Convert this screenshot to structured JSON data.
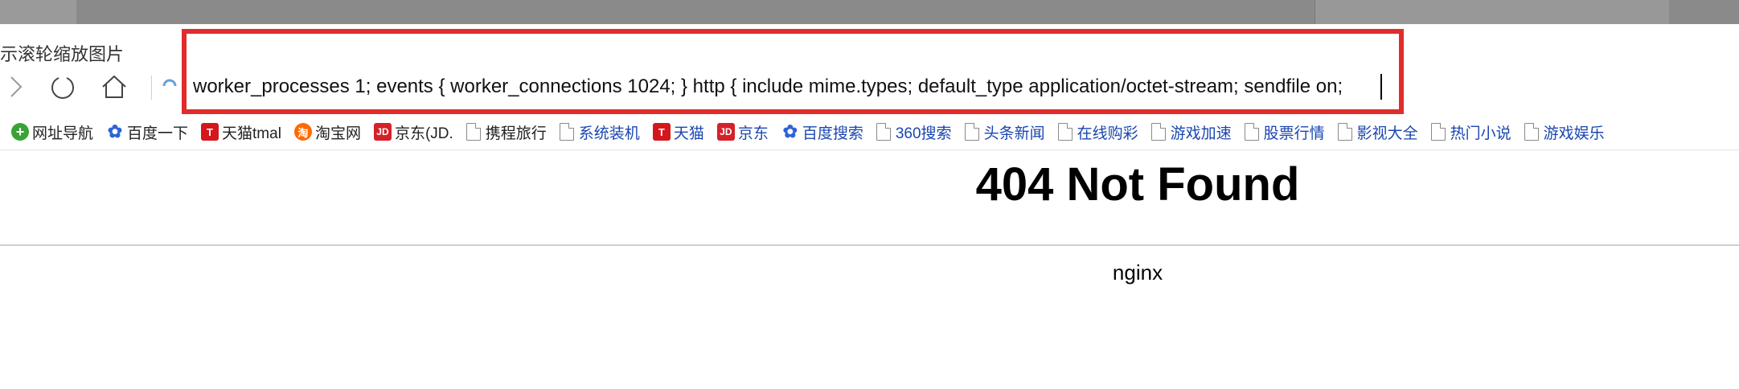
{
  "browser": {
    "tab_title": "示滚轮缩放图片",
    "address_bar_value": "worker_processes 1; events { worker_connections 1024; } http { include mime.types; default_type application/octet-stream; sendfile on;"
  },
  "bookmarks": [
    {
      "label": "网址导航",
      "icon": "green-plus-icon"
    },
    {
      "label": "百度一下",
      "icon": "baidu-paw-icon"
    },
    {
      "label": "天猫tmal",
      "icon": "tmall-icon"
    },
    {
      "label": "淘宝网",
      "icon": "taobao-icon"
    },
    {
      "label": "京东(JD.",
      "icon": "jd-icon"
    },
    {
      "label": "携程旅行",
      "icon": "page-icon"
    },
    {
      "label": "系统装机",
      "icon": "page-icon"
    },
    {
      "label": "天猫",
      "icon": "tmall-icon"
    },
    {
      "label": "京东",
      "icon": "jd-icon"
    },
    {
      "label": "百度搜索",
      "icon": "baidu-paw-icon"
    },
    {
      "label": "360搜索",
      "icon": "page-icon"
    },
    {
      "label": "头条新闻",
      "icon": "page-icon"
    },
    {
      "label": "在线购彩",
      "icon": "page-icon"
    },
    {
      "label": "游戏加速",
      "icon": "page-icon"
    },
    {
      "label": "股票行情",
      "icon": "page-icon"
    },
    {
      "label": "影视大全",
      "icon": "page-icon"
    },
    {
      "label": "热门小说",
      "icon": "page-icon"
    },
    {
      "label": "游戏娱乐",
      "icon": "page-icon"
    }
  ],
  "page": {
    "heading": "404 Not Found",
    "server": "nginx"
  },
  "colors": {
    "highlight_border": "#e02c2c",
    "link_blue": "#1a46b0"
  }
}
